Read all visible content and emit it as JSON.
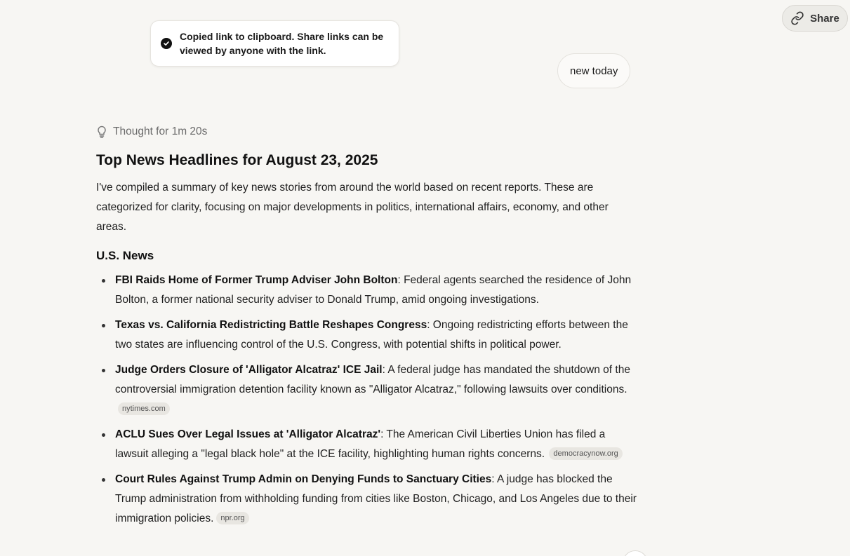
{
  "header": {
    "share_label": "Share",
    "share_icon": "link-icon"
  },
  "toast": {
    "message": "Copied link to clipboard. Share links can be viewed by anyone with the link.",
    "icon": "check-circle-icon"
  },
  "user_message": {
    "text": "new today"
  },
  "response": {
    "thought_label": "Thought for 1m 20s",
    "thought_icon": "lightbulb-icon",
    "title": "Top News Headlines for August 23, 2025",
    "intro": "I've compiled a summary of key news stories from around the world based on recent reports. These are categorized for clarity, focusing on major developments in politics, international affairs, economy, and other areas.",
    "section_us": "U.S. News",
    "items": [
      {
        "headline": "FBI Raids Home of Former Trump Adviser John Bolton",
        "body": ": Federal agents searched the residence of John Bolton, a former national security adviser to Donald Trump, amid ongoing investigations.",
        "source": ""
      },
      {
        "headline": "Texas vs. California Redistricting Battle Reshapes Congress",
        "body": ": Ongoing redistricting efforts between the two states are influencing control of the U.S. Congress, with potential shifts in political power.",
        "source": ""
      },
      {
        "headline": "Judge Orders Closure of 'Alligator Alcatraz' ICE Jail",
        "body": ": A federal judge has mandated the shutdown of the controversial immigration detention facility known as \"Alligator Alcatraz,\" following lawsuits over conditions.",
        "source": "nytimes.com"
      },
      {
        "headline": "ACLU Sues Over Legal Issues at 'Alligator Alcatraz'",
        "body": ": The American Civil Liberties Union has filed a lawsuit alleging a \"legal black hole\" at the ICE facility, highlighting human rights concerns.",
        "source": "democracynow.org"
      },
      {
        "headline": "Court Rules Against Trump Admin on Denying Funds to Sanctuary Cities",
        "body": ": A judge has blocked the Trump administration from withholding funding from cities like Boston, Chicago, and Los Angeles due to their immigration policies.",
        "source": "npr.org"
      }
    ]
  }
}
